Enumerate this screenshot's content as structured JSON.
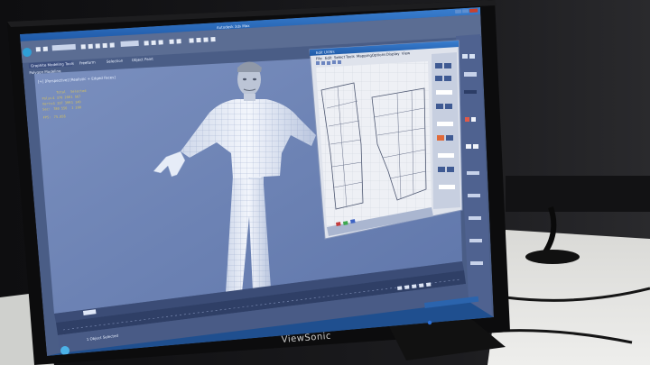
{
  "monitor": {
    "brand": "ViewSonic"
  },
  "app": {
    "title": "Autodesk 3ds Max",
    "ribbon_tabs": [
      "Graphite Modeling Tools",
      "Freeform",
      "Selection",
      "Object Paint"
    ],
    "ribbon_subtitle": "Polygon Modeling",
    "viewport_label": "[+] [Perspective] [Realistic + Edged Faces]",
    "stats": {
      "header": "Total",
      "header2": "Selected",
      "rows": [
        {
          "label": "Polys:",
          "value": "1 370 200",
          "sel": "1 567"
        },
        {
          "label": "Verts:",
          "value": "1 337 399",
          "sel": "1 140"
        },
        {
          "label": "Sec:",
          "value": "780 556",
          "sel": "1 200"
        },
        {
          "label": "FPS:",
          "value": "75.856",
          "sel": ""
        }
      ]
    },
    "uv_editor_title": "Edit UVWs",
    "uv_menu": [
      "File",
      "Edit",
      "Select",
      "Tools",
      "Mapping",
      "Options",
      "Display",
      "View"
    ],
    "timeline_frame": "0 / 100",
    "status_text": "1 Object Selected"
  },
  "colors": {
    "viewport_bg": "#6f86b8",
    "taskbar": "#1f4f8f",
    "bezel": "#0c0c0d",
    "stats_text": "#d8c25a"
  }
}
